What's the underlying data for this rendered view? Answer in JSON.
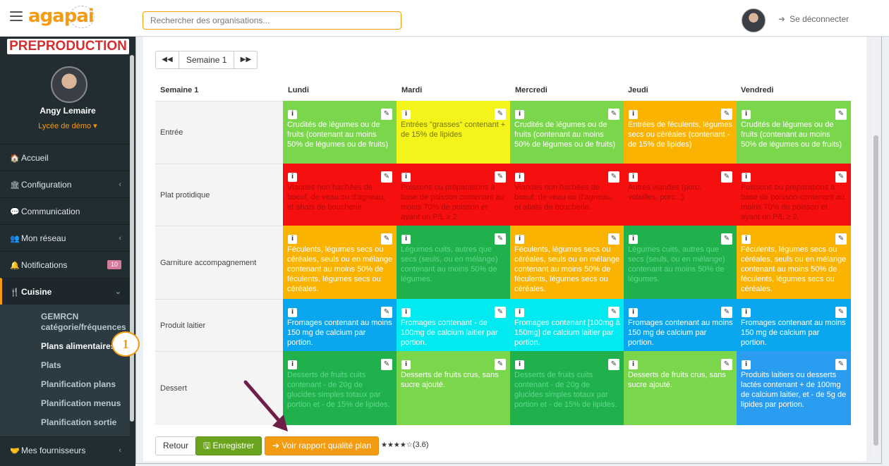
{
  "header": {
    "logo": "agapai",
    "search_placeholder": "Rechercher des organisations...",
    "logout_label": "Se déconnecter"
  },
  "sidebar": {
    "env_label": "PREPRODUCTION",
    "user_name": "Angy Lemaire",
    "school": "Lycée de démo ▾",
    "items": [
      {
        "icon": "🏠",
        "label": "Accueil",
        "chevron": "",
        "badge": ""
      },
      {
        "icon": "🏛",
        "label": "Configuration",
        "chevron": "‹",
        "badge": ""
      },
      {
        "icon": "💬",
        "label": "Communication",
        "chevron": "",
        "badge": ""
      },
      {
        "icon": "👥",
        "label": "Mon réseau",
        "chevron": "‹",
        "badge": ""
      },
      {
        "icon": "🔔",
        "label": "Notifications",
        "chevron": "",
        "badge": "10"
      },
      {
        "icon": "🍴",
        "label": "Cuisine",
        "chevron": "⌄",
        "badge": ""
      }
    ],
    "sub_items": [
      "GEMRCN catégorie/fréquences",
      "Plans alimentaires",
      "Plats",
      "Planification plans",
      "Planification menus",
      "Planification sortie"
    ],
    "last_item": {
      "icon": "🤝",
      "label": "Mes fournisseurs",
      "chevron": "‹"
    },
    "step_marker": "1"
  },
  "week_nav": {
    "prev": "◀◀",
    "label": "Semaine 1",
    "next": "▶▶"
  },
  "table": {
    "corner_header": "Semaine 1",
    "days": [
      "Lundi",
      "Mardi",
      "Mercredi",
      "Jeudi",
      "Vendredi"
    ],
    "rows": [
      {
        "label": "Entrée",
        "cells": [
          {
            "text": "Crudités de légumes ou de fruits (contenant au moins 50% de légumes ou de fruits)",
            "bg": "#7ad64a",
            "fg": "#ffffff"
          },
          {
            "text": "Entrées \"grasses\" contenant + de 15% de lipides",
            "bg": "#f4f41b",
            "fg": "#777700"
          },
          {
            "text": "Crudités de légumes ou de fruits (contenant au moins 50% de légumes ou de fruits)",
            "bg": "#7ad64a",
            "fg": "#ffffff"
          },
          {
            "text": "Entrées de féculents, légumes secs ou céréales (contenant - de 15% de lipides)",
            "bg": "#f9b300",
            "fg": "#ffffff"
          },
          {
            "text": "Crudités de légumes ou de fruits (contenant au moins 50% de légumes ou de fruits)",
            "bg": "#7ad64a",
            "fg": "#ffffff"
          }
        ]
      },
      {
        "label": "Plat protidique",
        "cells": [
          {
            "text": "Viandes non hachées de boeuf, de veau ou d'agneau, et abats de boucherie.",
            "bg": "#f50f0f",
            "fg": "#b50a0a"
          },
          {
            "text": "Poissons ou préparations à base de poisson contenant au moins 70% de poisson et ayant un P/L ≥ 2.",
            "bg": "#f50f0f",
            "fg": "#b50a0a"
          },
          {
            "text": "Viandes non hachées de boeuf, de veau ou d'agneau, et abats de boucherie.",
            "bg": "#f50f0f",
            "fg": "#b50a0a"
          },
          {
            "text": "Autres viandes (porc, volailles, porc...)",
            "bg": "#f50f0f",
            "fg": "#b50a0a"
          },
          {
            "text": "Poissons ou préparations à base de poisson contenant au moins 70% de poisson et ayant un P/L ≥ 2.",
            "bg": "#f50f0f",
            "fg": "#b50a0a"
          }
        ]
      },
      {
        "label": "Garniture accompagnement",
        "cells": [
          {
            "text": "Féculents, légumes secs ou céréales, seuls ou en mélange contenant au moins 50% de féculents, légumes secs ou céréales.",
            "bg": "#f9b300",
            "fg": "#ffffff"
          },
          {
            "text": "Légumes cuits, autres que secs (seuls, ou en mélange) contenant au moins 50% de légumes.",
            "bg": "#20b14c",
            "fg": "#5fd88a"
          },
          {
            "text": "Féculents, légumes secs ou céréales, seuls ou en mélange contenant au moins 50% de féculents, légumes secs ou céréales.",
            "bg": "#f9b300",
            "fg": "#ffffff"
          },
          {
            "text": "Légumes cuits, autres que secs (seuls, ou en mélange) contenant au moins 50% de légumes.",
            "bg": "#20b14c",
            "fg": "#5fd88a"
          },
          {
            "text": "Féculents, légumes secs ou céréales, seuls ou en mélange contenant au moins 50% de féculents, légumes secs ou céréales.",
            "bg": "#f9b300",
            "fg": "#ffffff"
          }
        ]
      },
      {
        "label": "Produit laitier",
        "cells": [
          {
            "text": "Fromages contenant au moins 150 mg de calcium par portion.",
            "bg": "#0aa7ef",
            "fg": "#ffffff"
          },
          {
            "text": "Fromages contenant - de 100mg de calcium laitier par portion.",
            "bg": "#00eaf0",
            "fg": "#ffffff"
          },
          {
            "text": "Fromages contenant [100mg à 150mg] de calcium laitier par portion.",
            "bg": "#00eaf0",
            "fg": "#ffffff"
          },
          {
            "text": "Fromages contenant au moins 150 mg de calcium par portion.",
            "bg": "#0aa7ef",
            "fg": "#ffffff"
          },
          {
            "text": "Fromages contenant au moins 150 mg de calcium par portion.",
            "bg": "#0aa7ef",
            "fg": "#ffffff"
          }
        ]
      },
      {
        "label": "Dessert",
        "cells": [
          {
            "text": "Desserts de fruits cuits contenant - de 20g de glucides simples totaux par portion et - de 15% de lipides.",
            "bg": "#20b14c",
            "fg": "#5fd88a"
          },
          {
            "text": "Desserts de fruits crus, sans sucre ajouté.",
            "bg": "#7ad64a",
            "fg": "#ffffff"
          },
          {
            "text": "Desserts de fruits cuits contenant - de 20g de glucides simples totaux par portion et - de 15% de lipides.",
            "bg": "#20b14c",
            "fg": "#5fd88a"
          },
          {
            "text": "Desserts de fruits crus, sans sucre ajouté.",
            "bg": "#7ad64a",
            "fg": "#ffffff"
          },
          {
            "text": "Produits laitiers ou desserts lactés contenant + de 100mg de calcium laitier, et - de 5g de lipides par portion.",
            "bg": "#2b9df0",
            "fg": "#ffffff"
          }
        ]
      }
    ],
    "info_glyph": "i",
    "edit_glyph": "✎"
  },
  "footer": {
    "retour_label": "Retour",
    "save_label": "🖫 Enregistrer",
    "rapport_label": "➔ Voir rapport qualité plan",
    "stars": "★★★★☆",
    "rating": "(3.6)"
  },
  "colors": {
    "accent": "#f39c12",
    "sidebar_bg": "#222d32",
    "save_green": "#6aa31e"
  }
}
